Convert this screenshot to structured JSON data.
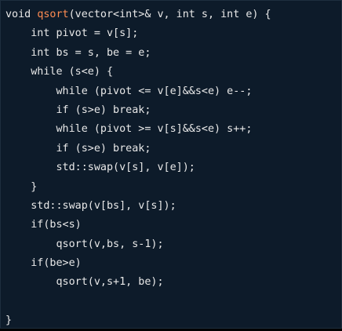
{
  "colors": {
    "background": "#0d1b2a",
    "text": "#e8e8e8",
    "function_name": "#ff8c52"
  },
  "code": {
    "lines": [
      {
        "indent": "",
        "segments": [
          "void ",
          "qsort",
          "(vector<int>& v, int s, int e) {"
        ]
      },
      {
        "indent": "    ",
        "text": "int pivot = v[s];"
      },
      {
        "indent": "    ",
        "text": "int bs = s, be = e;"
      },
      {
        "indent": "    ",
        "text": "while (s<e) {"
      },
      {
        "indent": "        ",
        "text": "while (pivot <= v[e]&&s<e) e--;"
      },
      {
        "indent": "        ",
        "text": "if (s>e) break;"
      },
      {
        "indent": "        ",
        "text": "while (pivot >= v[s]&&s<e) s++;"
      },
      {
        "indent": "        ",
        "text": "if (s>e) break;"
      },
      {
        "indent": "        ",
        "text": "std::swap(v[s], v[e]);"
      },
      {
        "indent": "    ",
        "text": "}"
      },
      {
        "indent": "    ",
        "text": "std::swap(v[bs], v[s]);"
      },
      {
        "indent": "    ",
        "text": "if(bs<s)"
      },
      {
        "indent": "        ",
        "text": "qsort(v,bs, s-1);"
      },
      {
        "indent": "    ",
        "text": "if(be>e)"
      },
      {
        "indent": "        ",
        "text": "qsort(v,s+1, be);"
      },
      {
        "indent": "",
        "text": ""
      },
      {
        "indent": "",
        "text": "}"
      }
    ]
  }
}
